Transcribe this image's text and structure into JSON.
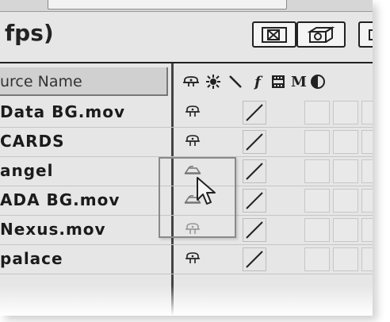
{
  "window": {
    "title_fragment": "fps)"
  },
  "toolbar": {
    "shy_toggle_icon": "shy-layers-icon",
    "three_d_toggle_icon": "3d-draft-icon"
  },
  "column_header": {
    "source_name": "urce Name"
  },
  "switch_headers": [
    {
      "name": "shy-icon",
      "glyph": "⚑"
    },
    {
      "name": "collapse-transformations-icon",
      "glyph": "✷"
    },
    {
      "name": "quality-icon",
      "glyph": "\\"
    },
    {
      "name": "effect-icon",
      "glyph": "f"
    },
    {
      "name": "frame-blending-icon",
      "glyph": "▦"
    },
    {
      "name": "motion-blur-icon",
      "glyph": "M"
    },
    {
      "name": "adjustment-layer-icon",
      "glyph": "◐"
    }
  ],
  "layers": [
    {
      "name": "Data BG.mov",
      "shy_state": "normal"
    },
    {
      "name": "CARDS",
      "shy_state": "normal"
    },
    {
      "name": "angel",
      "shy_state": "shy"
    },
    {
      "name": "ADA BG.mov",
      "shy_state": "shy"
    },
    {
      "name": "Nexus.mov",
      "shy_state": "faded"
    },
    {
      "name": "palace",
      "shy_state": "normal"
    }
  ],
  "colors": {
    "panel_bg": "#e6e6e6",
    "header_bg": "#d0d0d0",
    "text": "#1b1b1b"
  }
}
